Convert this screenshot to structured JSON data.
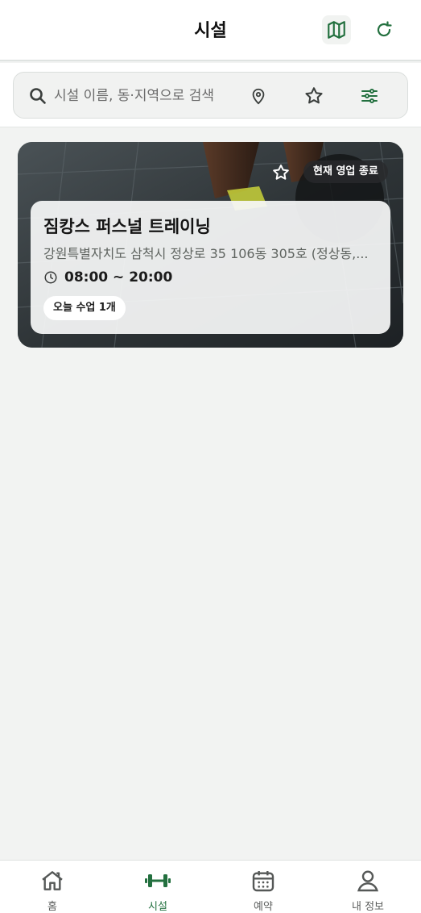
{
  "header": {
    "title": "시설",
    "map_icon": "map-icon",
    "refresh_icon": "refresh-icon"
  },
  "search": {
    "placeholder": "시설 이름, 동·지역으로 검색",
    "value": "",
    "icons": [
      "search-icon",
      "location-pin-icon",
      "star-icon",
      "filter-sliders-icon"
    ]
  },
  "facilities": [
    {
      "name": "짐캉스 퍼스널 트레이닝",
      "address": "강원특별자치도 삼척시 정상로 35 106동 305호 (정상동,...",
      "hours": "08:00 ~ 20:00",
      "status": "현재 영업 종료",
      "classes_today": "오늘 수업 1개",
      "favorite": false
    }
  ],
  "tabs": [
    {
      "label": "홈",
      "icon": "home-icon",
      "active": false
    },
    {
      "label": "시설",
      "icon": "dumbbell-icon",
      "active": true
    },
    {
      "label": "예약",
      "icon": "calendar-icon",
      "active": false
    },
    {
      "label": "내 정보",
      "icon": "user-icon",
      "active": false
    }
  ],
  "colors": {
    "accent": "#23703f",
    "background": "#f2f3f2",
    "inactive": "#5d5f5e"
  }
}
